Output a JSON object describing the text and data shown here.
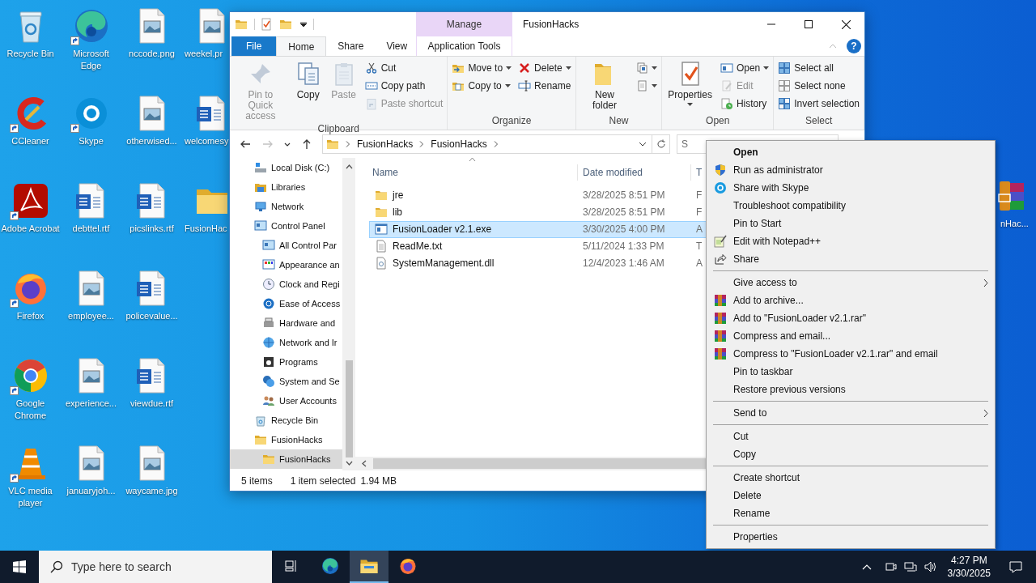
{
  "desktop": {
    "columns": [
      [
        {
          "label": "Recycle Bin",
          "kind": "recycle",
          "shortcut": false
        },
        {
          "label": "CCleaner",
          "kind": "ccleaner",
          "shortcut": true
        },
        {
          "label": "Adobe Acrobat",
          "kind": "acrobat",
          "shortcut": true
        },
        {
          "label": "Firefox",
          "kind": "firefox",
          "shortcut": true
        },
        {
          "label": "Google Chrome",
          "kind": "chrome",
          "shortcut": true
        },
        {
          "label": "VLC media player",
          "kind": "vlc",
          "shortcut": true
        }
      ],
      [
        {
          "label": "Microsoft Edge",
          "kind": "edge",
          "shortcut": true
        },
        {
          "label": "Skype",
          "kind": "skype",
          "shortcut": true
        },
        {
          "label": "debttel.rtf",
          "kind": "word",
          "shortcut": false
        },
        {
          "label": "employee...",
          "kind": "image",
          "shortcut": false
        },
        {
          "label": "experience...",
          "kind": "image",
          "shortcut": false
        },
        {
          "label": "januaryjoh...",
          "kind": "image",
          "shortcut": false
        }
      ],
      [
        {
          "label": "nccode.png",
          "kind": "image",
          "shortcut": false
        },
        {
          "label": "otherwised...",
          "kind": "image",
          "shortcut": false
        },
        {
          "label": "picslinks.rtf",
          "kind": "word",
          "shortcut": false
        },
        {
          "label": "policevalue...",
          "kind": "word",
          "shortcut": false
        },
        {
          "label": "viewdue.rtf",
          "kind": "word",
          "shortcut": false
        },
        {
          "label": "waycame.jpg",
          "kind": "image",
          "shortcut": false
        }
      ],
      [
        {
          "label": "weekel.pr",
          "kind": "image",
          "shortcut": false
        },
        {
          "label": "welcomesy",
          "kind": "word",
          "shortcut": false
        },
        {
          "label": "FusionHac",
          "kind": "folder",
          "shortcut": false
        }
      ]
    ],
    "partly_hidden_icon": {
      "label": "nHac...",
      "kind": "winrar",
      "shortcut": false
    }
  },
  "explorer": {
    "title": "FusionHacks",
    "help": "?",
    "tabs": [
      {
        "label": "File",
        "kind": "file",
        "selected": false
      },
      {
        "label": "Home",
        "kind": "tab",
        "selected": true
      },
      {
        "label": "Share",
        "kind": "tab",
        "selected": false
      },
      {
        "label": "View",
        "kind": "tab",
        "selected": false
      }
    ],
    "context_tab_group": {
      "label": "Manage",
      "tab": {
        "label": "Application Tools",
        "selected": false
      }
    },
    "ribbon": {
      "groups": [
        {
          "label": "Clipboard",
          "large": [
            {
              "kind": "pin",
              "label": "Pin to Quick access",
              "disabled": true
            },
            {
              "kind": "copy",
              "label": "Copy",
              "disabled": false
            },
            {
              "kind": "paste",
              "label": "Paste",
              "disabled": true
            }
          ],
          "columns": [
            [
              {
                "kind": "cut",
                "label": "Cut",
                "disabled": false,
                "dropdown": false
              },
              {
                "kind": "copypath",
                "label": "Copy path",
                "disabled": false,
                "dropdown": false
              },
              {
                "kind": "pasteshortcut",
                "label": "Paste shortcut",
                "disabled": true,
                "dropdown": false
              }
            ]
          ]
        },
        {
          "label": "Organize",
          "columns": [
            [
              {
                "kind": "moveto",
                "label": "Move to",
                "disabled": false,
                "dropdown": true
              },
              {
                "kind": "copyto",
                "label": "Copy to",
                "disabled": false,
                "dropdown": true
              }
            ],
            [
              {
                "kind": "delete",
                "label": "Delete",
                "disabled": false,
                "dropdown": true
              },
              {
                "kind": "rename",
                "label": "Rename",
                "disabled": false,
                "dropdown": false
              }
            ]
          ]
        },
        {
          "label": "New",
          "large": [
            {
              "kind": "newfolder",
              "label": "New folder",
              "disabled": false
            }
          ],
          "columns": [
            [
              {
                "kind": "newitem",
                "disabled": false,
                "dropdown": true
              },
              {
                "kind": "easyaccess",
                "disabled": false,
                "dropdown": true
              }
            ]
          ]
        },
        {
          "label": "Open",
          "large": [
            {
              "kind": "properties",
              "label": "Properties",
              "disabled": false,
              "dropdown": true
            }
          ],
          "columns": [
            [
              {
                "kind": "open",
                "label": "Open",
                "disabled": false,
                "dropdown": true
              },
              {
                "kind": "edit",
                "label": "Edit",
                "disabled": true,
                "dropdown": false
              },
              {
                "kind": "history",
                "label": "History",
                "disabled": false,
                "dropdown": false
              }
            ]
          ]
        },
        {
          "label": "Select",
          "columns": [
            [
              {
                "kind": "selectall",
                "label": "Select all",
                "disabled": false,
                "dropdown": false
              },
              {
                "kind": "selectnone",
                "label": "Select none",
                "disabled": false,
                "dropdown": false
              },
              {
                "kind": "invert",
                "label": "Invert selection",
                "disabled": false,
                "dropdown": false
              }
            ]
          ]
        }
      ]
    },
    "nav_buttons": [
      {
        "kind": "back",
        "disabled": false
      },
      {
        "kind": "forward",
        "disabled": true
      },
      {
        "kind": "recent",
        "disabled": false
      },
      {
        "kind": "up",
        "disabled": false
      }
    ],
    "address": {
      "path": [
        "FusionHacks",
        "FusionHacks"
      ]
    },
    "search": {
      "placeholder": "S"
    },
    "nav_tree": [
      {
        "label": "Local Disk (C:)",
        "kind": "drive",
        "selected": false
      },
      {
        "label": "Libraries",
        "kind": "libraries",
        "selected": false
      },
      {
        "label": "Network",
        "kind": "network",
        "selected": false
      },
      {
        "label": "Control Panel",
        "kind": "control",
        "selected": false,
        "children": [
          {
            "label": "All Control Par",
            "kind": "control",
            "selected": false
          },
          {
            "label": "Appearance an",
            "kind": "appearance",
            "selected": false
          },
          {
            "label": "Clock and Regi",
            "kind": "clock",
            "selected": false
          },
          {
            "label": "Ease of Access",
            "kind": "ease",
            "selected": false
          },
          {
            "label": "Hardware and",
            "kind": "hardware",
            "selected": false
          },
          {
            "label": "Network and Ir",
            "kind": "netint",
            "selected": false
          },
          {
            "label": "Programs",
            "kind": "programs",
            "selected": false
          },
          {
            "label": "System and Se",
            "kind": "system",
            "selected": false
          },
          {
            "label": "User Accounts",
            "kind": "users",
            "selected": false
          }
        ]
      },
      {
        "label": "Recycle Bin",
        "kind": "recycle",
        "selected": false
      },
      {
        "label": "FusionHacks",
        "kind": "folder",
        "selected": false,
        "children": [
          {
            "label": "FusionHacks",
            "kind": "folder",
            "selected": true
          }
        ]
      }
    ],
    "columns": [
      "Name",
      "Date modified",
      "T"
    ],
    "files": [
      {
        "name": "jre",
        "date_modified": "3/28/2025 8:51 PM",
        "column_3": "F",
        "kind": "folder",
        "selected": false
      },
      {
        "name": "lib",
        "date_modified": "3/28/2025 8:51 PM",
        "column_3": "F",
        "kind": "folder",
        "selected": false
      },
      {
        "name": "FusionLoader v2.1.exe",
        "date_modified": "3/30/2025 4:00 PM",
        "column_3": "A",
        "kind": "exe",
        "selected": true
      },
      {
        "name": "ReadMe.txt",
        "date_modified": "5/11/2024 1:33 PM",
        "column_3": "T",
        "kind": "text",
        "selected": false
      },
      {
        "name": "SystemManagement.dll",
        "date_modified": "12/4/2023 1:46 AM",
        "column_3": "A",
        "kind": "dll",
        "selected": false
      }
    ],
    "status": {
      "count": "5 items",
      "selection": "1 item selected",
      "size": "1.94 MB"
    }
  },
  "context_menu": {
    "items": [
      {
        "label": "Open",
        "kind": "default"
      },
      {
        "label": "Run as administrator",
        "kind": "shield"
      },
      {
        "label": "Share with Skype",
        "kind": "skype"
      },
      {
        "label": "Troubleshoot compatibility",
        "kind": "plain"
      },
      {
        "label": "Pin to Start",
        "kind": "plain"
      },
      {
        "label": "Edit with Notepad++",
        "kind": "notepad"
      },
      {
        "label": "Share",
        "kind": "share"
      },
      {
        "kind": "separator"
      },
      {
        "label": "Give access to",
        "kind": "submenu"
      },
      {
        "label": "Add to archive...",
        "kind": "winrar"
      },
      {
        "label": "Add to \"FusionLoader v2.1.rar\"",
        "kind": "winrar"
      },
      {
        "label": "Compress and email...",
        "kind": "winrar"
      },
      {
        "label": "Compress to \"FusionLoader v2.1.rar\" and email",
        "kind": "winrar"
      },
      {
        "label": "Pin to taskbar",
        "kind": "plain"
      },
      {
        "label": "Restore previous versions",
        "kind": "plain"
      },
      {
        "kind": "separator"
      },
      {
        "label": "Send to",
        "kind": "submenu"
      },
      {
        "kind": "separator"
      },
      {
        "label": "Cut",
        "kind": "plain"
      },
      {
        "label": "Copy",
        "kind": "plain"
      },
      {
        "kind": "separator"
      },
      {
        "label": "Create shortcut",
        "kind": "plain"
      },
      {
        "label": "Delete",
        "kind": "plain"
      },
      {
        "label": "Rename",
        "kind": "plain"
      },
      {
        "kind": "separator"
      },
      {
        "label": "Properties",
        "kind": "plain"
      }
    ]
  },
  "taskbar": {
    "search_placeholder": "Type here to search",
    "apps": [
      {
        "kind": "taskview",
        "selected": false
      },
      {
        "kind": "edge",
        "selected": false
      },
      {
        "kind": "explorer",
        "selected": true
      },
      {
        "kind": "firefox",
        "selected": false
      }
    ],
    "time": "4:27 PM",
    "date": "3/30/2025"
  }
}
